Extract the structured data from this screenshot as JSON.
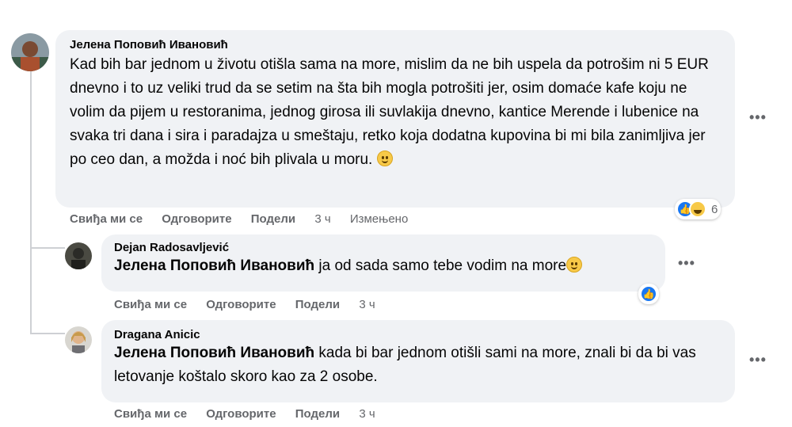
{
  "comments": [
    {
      "author": "Јелена Поповић Ивановић",
      "mention": "",
      "text": "Kad bih bar jednom u životu otišla sama na more, mislim da ne bih uspela da potrošim ni 5 EUR dnevno i to uz veliki trud da se setim na šta bih mogla potrošiti jer, osim domaće kafe koju ne volim da pijem u restoranima, jednog girosa ili suvlakija dnevno, kantice Merende i lubenice na svaka tri dana i sira i paradajza u smeštaju, retko koja dodatna kupovina bi mi bila zanimljiva jer po ceo dan, a možda i noć bih plivala u moru.",
      "like": "Свиђа ми се",
      "reply": "Одговорите",
      "share": "Подели",
      "time": "3 ч",
      "edited": "Измењено",
      "reaction_count": "6",
      "reactions": [
        "like-icon",
        "haha-icon"
      ]
    },
    {
      "author": "Dejan Radosavljević",
      "mention": "Јелена Поповић Ивановић",
      "text": " ja od sada samo tebe vodim na more",
      "like": "Свиђа ми се",
      "reply": "Одговорите",
      "share": "Подели",
      "time": "3 ч",
      "reactions": [
        "like-icon"
      ]
    },
    {
      "author": "Dragana Anicic",
      "mention": "Јелена Поповић Ивановић",
      "text": " kada bi bar jednom otišli sami na more, znali bi da bi vas letovanje koštalo skoro kao za 2 osobe.",
      "like": "Свиђа ми се",
      "reply": "Одговорите",
      "share": "Подели",
      "time": "3 ч"
    }
  ],
  "more_icon": "•••",
  "colors": {
    "bubble": "#f0f2f5",
    "meta": "#65676b",
    "like_blue": "#1877f2"
  }
}
